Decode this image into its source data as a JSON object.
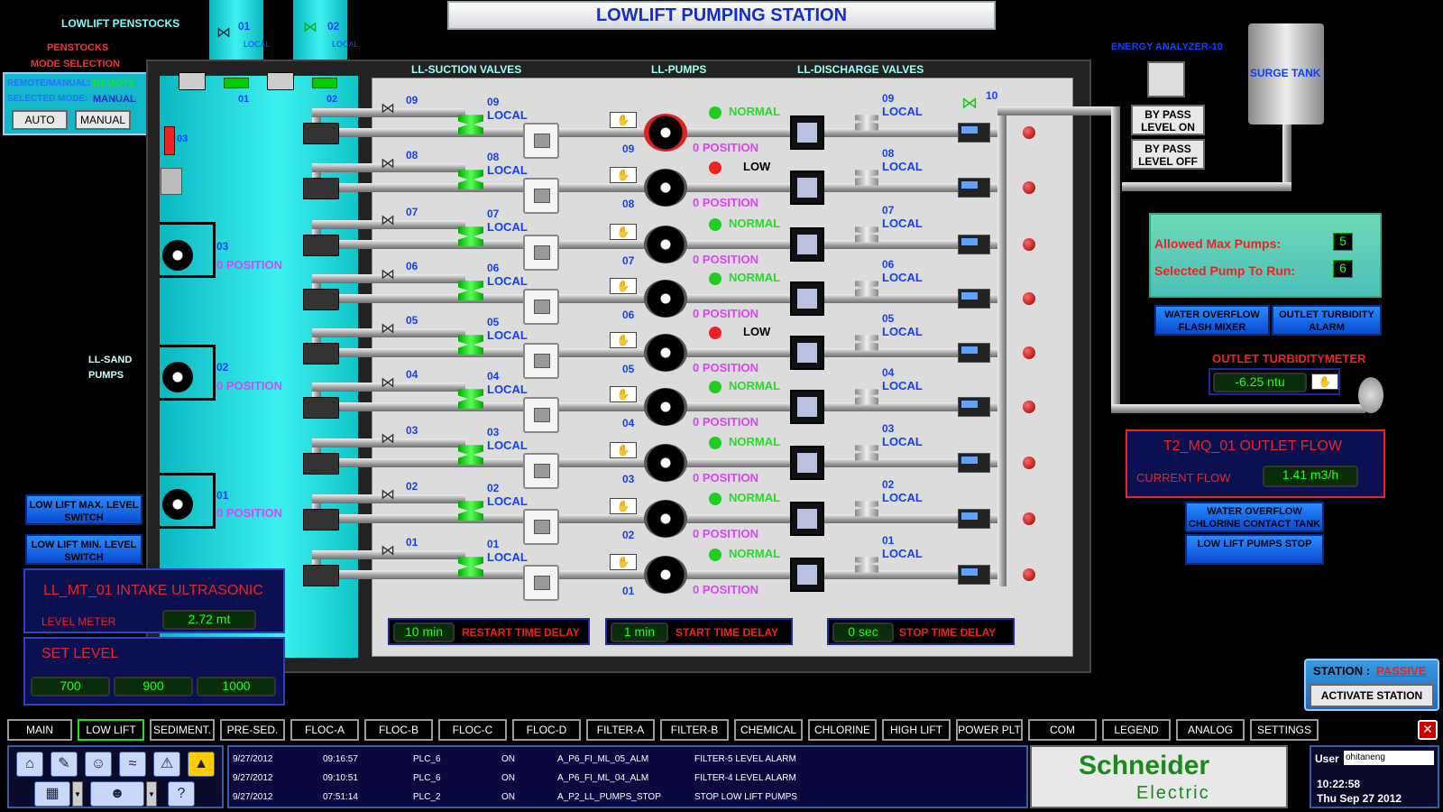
{
  "title": "LOWLIFT PUMPING STATION",
  "penstocks": {
    "title": "LOWLIFT PENSTOCKS",
    "mode_title_1": "PENSTOCKS",
    "mode_title_2": "MODE SELECTION",
    "remote_label": "REMOTE/MANUAL:",
    "remote_value": "REMOTE",
    "selected_label": "SELECTED MODE:",
    "selected_value": "MANUAL",
    "auto_btn": "AUTO",
    "manual_btn": "MANUAL",
    "g01": "01",
    "g02": "02",
    "g03": "03",
    "local": "LOCAL",
    "v01": "01",
    "v02": "02"
  },
  "headers": {
    "suction": "LL-SUCTION VALVES",
    "pumps": "LL-PUMPS",
    "discharge": "LL-DISCHARGE VALVES"
  },
  "sand_pumps": {
    "label_1": "LL-SAND",
    "label_2": "PUMPS",
    "items": [
      {
        "id": "03",
        "status": "0 POSITION"
      },
      {
        "id": "02",
        "status": "0 POSITION"
      },
      {
        "id": "01",
        "status": "0 POSITION"
      }
    ]
  },
  "rows": [
    {
      "id": "09",
      "suction": "LOCAL",
      "pump_status": "NORMAL",
      "position": "0 POSITION",
      "discharge": "LOCAL"
    },
    {
      "id": "08",
      "suction": "LOCAL",
      "pump_status": "LOW",
      "position": "0 POSITION",
      "discharge": "LOCAL"
    },
    {
      "id": "07",
      "suction": "LOCAL",
      "pump_status": "NORMAL",
      "position": "0 POSITION",
      "discharge": "LOCAL"
    },
    {
      "id": "06",
      "suction": "LOCAL",
      "pump_status": "NORMAL",
      "position": "0 POSITION",
      "discharge": "LOCAL"
    },
    {
      "id": "05",
      "suction": "LOCAL",
      "pump_status": "LOW",
      "position": "0 POSITION",
      "discharge": "LOCAL"
    },
    {
      "id": "04",
      "suction": "LOCAL",
      "pump_status": "NORMAL",
      "position": "0 POSITION",
      "discharge": "LOCAL"
    },
    {
      "id": "03",
      "suction": "LOCAL",
      "pump_status": "NORMAL",
      "position": "0 POSITION",
      "discharge": "LOCAL"
    },
    {
      "id": "02",
      "suction": "LOCAL",
      "pump_status": "NORMAL",
      "position": "0 POSITION",
      "discharge": "LOCAL"
    },
    {
      "id": "01",
      "suction": "LOCAL",
      "pump_status": "NORMAL",
      "position": "0 POSITION",
      "discharge": "LOCAL"
    }
  ],
  "valve10": "10",
  "delays": {
    "restart_value": "10 min",
    "restart_label": "RESTART TIME DELAY",
    "start_value": "1 min",
    "start_label": "START TIME DELAY",
    "stop_value": "0 sec",
    "stop_label": "STOP TIME DELAY"
  },
  "left_buttons": {
    "max_switch": "LOW LIFT MAX. LEVEL SWITCH",
    "min_switch": "LOW LIFT MIN. LEVEL SWITCH"
  },
  "intake": {
    "title": "LL_MT_01 INTAKE ULTRASONIC",
    "meter_label": "LEVEL METER",
    "meter_value": "2.72  mt",
    "set_title": "SET LEVEL",
    "set_values": [
      "700",
      "900",
      "1000"
    ]
  },
  "right": {
    "energy": "ENERGY ANALYZER-10",
    "surge": "SURGE TANK",
    "bypass_on": "BY PASS LEVEL ON",
    "bypass_off": "BY PASS LEVEL OFF",
    "max_pumps_label": "Allowed Max Pumps:",
    "max_pumps_value": "5",
    "selected_label": "Selected Pump To Run:",
    "selected_value": "6",
    "overflow_flash": "WATER OVERFLOW FLASH MIXER",
    "turbidity_alarm": "OUTLET TURBIDITY ALARM",
    "turbidity_title": "OUTLET TURBIDITYMETER",
    "turbidity_value": "-6.25  ntu",
    "flow_title": "T2_MQ_01 OUTLET FLOW",
    "flow_label": "CURRENT FLOW",
    "flow_value": "1.41  m3/h",
    "overflow_chlorine": "WATER OVERFLOW CHLORINE CONTACT TANK",
    "pumps_stop": "LOW LIFT PUMPS STOP",
    "station_label": "STATION :",
    "station_value": "PASSIVE",
    "activate": "ACTIVATE STATION"
  },
  "tabs": [
    "MAIN",
    "LOW LIFT",
    "SEDIMENT.",
    "PRE-SED.",
    "FLOC-A",
    "FLOC-B",
    "FLOC-C",
    "FLOC-D",
    "FILTER-A",
    "FILTER-B",
    "CHEMICAL",
    "CHLORINE",
    "HIGH LIFT",
    "POWER PLT",
    "COM",
    "LEGEND",
    "ANALOG",
    "SETTINGS"
  ],
  "active_tab": "LOW LIFT",
  "events": [
    {
      "date": "9/27/2012",
      "time": "09:16:57",
      "plc": "PLC_6",
      "state": "ON",
      "tag": "A_P6_FI_ML_05_ALM",
      "desc": "FILTER-5 LEVEL ALARM"
    },
    {
      "date": "9/27/2012",
      "time": "09:10:51",
      "plc": "PLC_6",
      "state": "ON",
      "tag": "A_P6_FI_ML_04_ALM",
      "desc": "FILTER-4 LEVEL ALARM"
    },
    {
      "date": "9/27/2012",
      "time": "07:51:14",
      "plc": "PLC_2",
      "state": "ON",
      "tag": "A_P2_LL_PUMPS_STOP",
      "desc": "STOP LOW LIFT PUMPS"
    }
  ],
  "brand_1": "Schneider",
  "brand_2": "Electric",
  "user_label": "User",
  "user_value": "ohitaneng",
  "clock_time": "10:22:58",
  "clock_date": "Thu Sep 27 2012"
}
